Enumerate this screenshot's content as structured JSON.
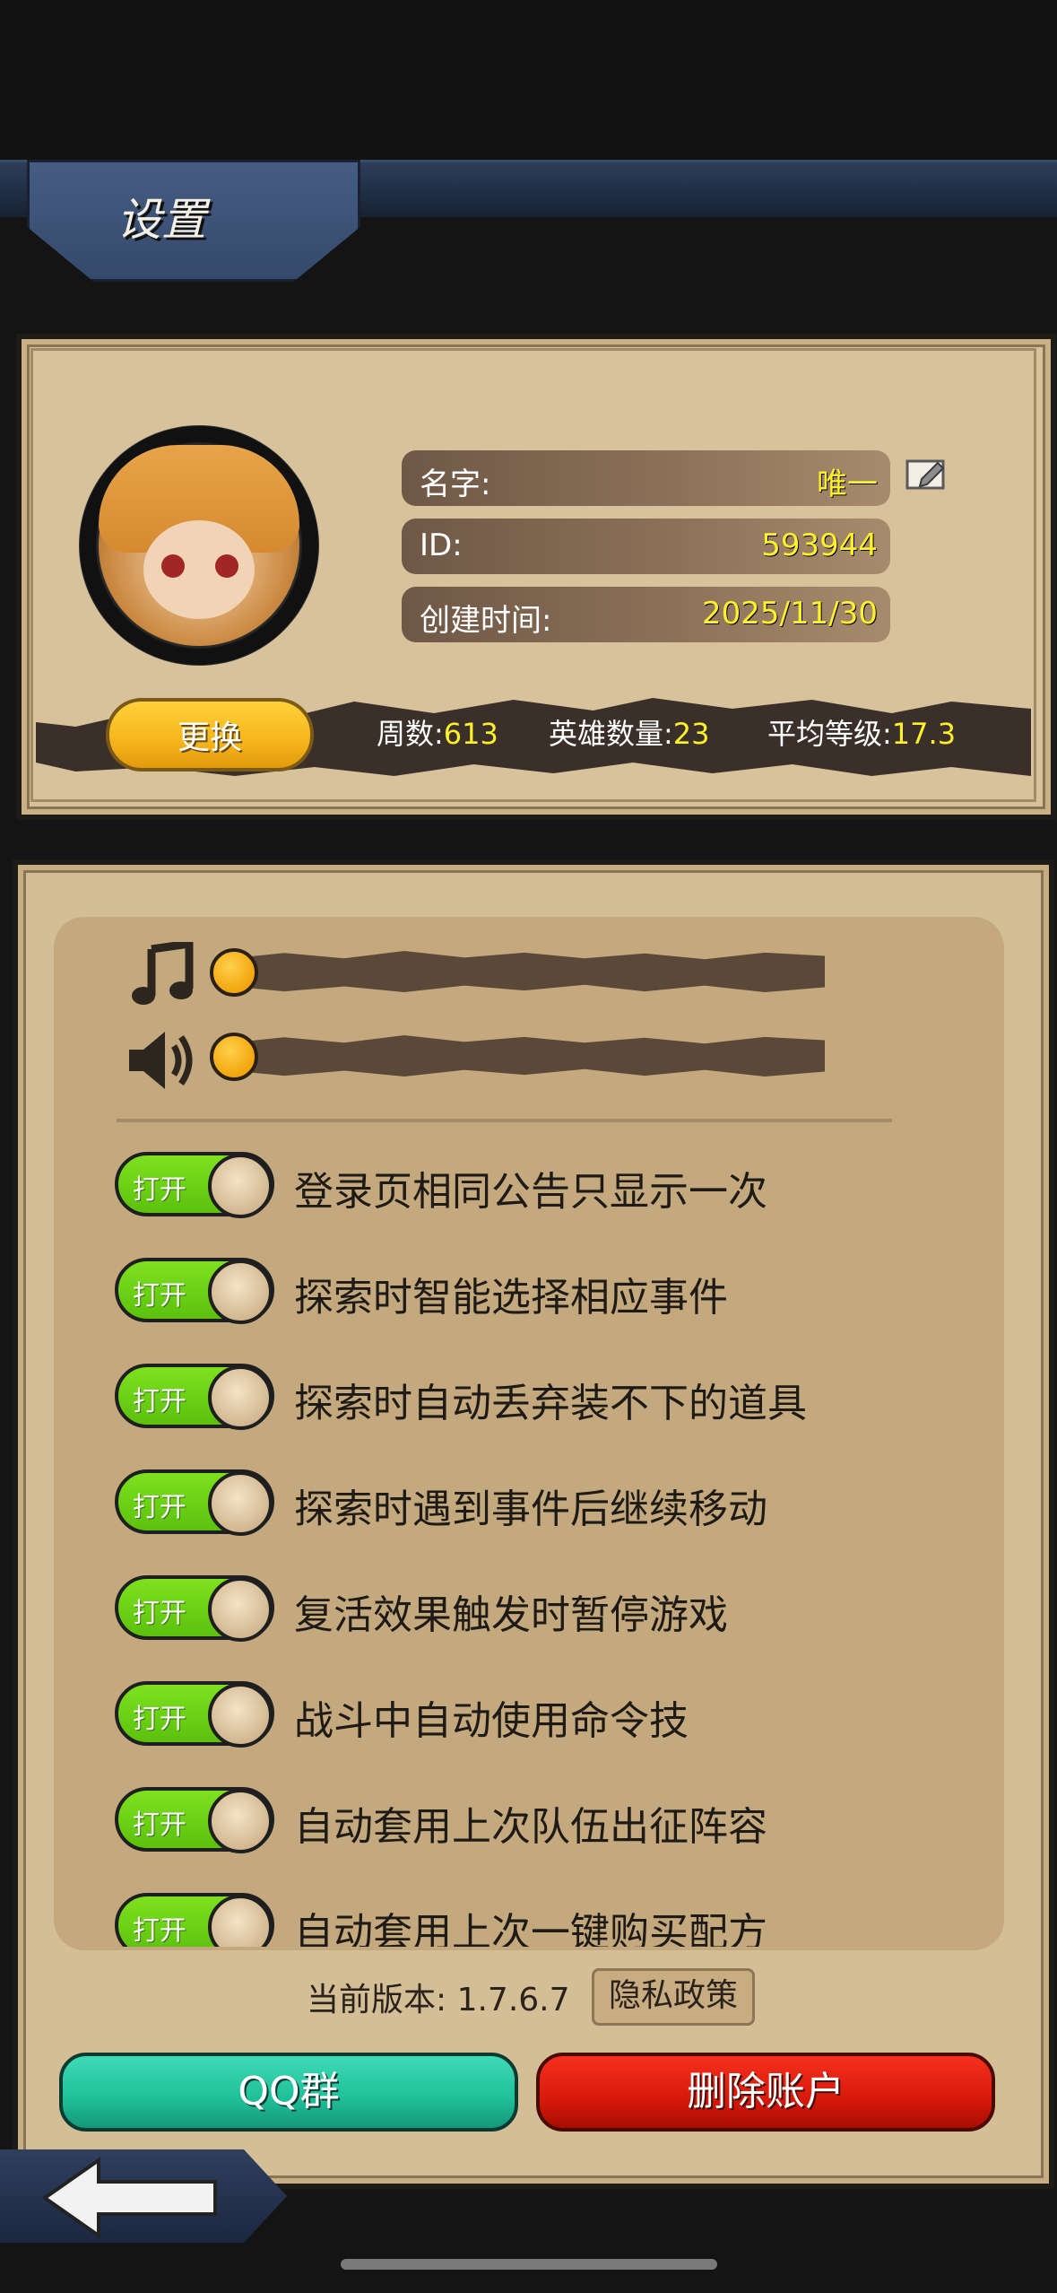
{
  "header": {
    "title": "设置"
  },
  "profile": {
    "name_label": "名字:",
    "name_value": "唯一",
    "id_label": "ID:",
    "id_value": "593944",
    "created_label": "创建时间:",
    "created_value": "2025/11/30",
    "change_button": "更换",
    "stats": {
      "weeks_label": "周数:",
      "weeks_value": "613",
      "heroes_label": "英雄数量:",
      "heroes_value": "23",
      "avg_level_label": "平均等级:",
      "avg_level_value": "17.3"
    }
  },
  "audio": {
    "music_icon": "music-note-icon",
    "sound_icon": "speaker-icon",
    "music_level": 0,
    "sound_level": 0
  },
  "toggles": [
    {
      "state": "打开",
      "label": "登录页相同公告只显示一次"
    },
    {
      "state": "打开",
      "label": "探索时智能选择相应事件"
    },
    {
      "state": "打开",
      "label": "探索时自动丢弃装不下的道具"
    },
    {
      "state": "打开",
      "label": "探索时遇到事件后继续移动"
    },
    {
      "state": "打开",
      "label": "复活效果触发时暂停游戏"
    },
    {
      "state": "打开",
      "label": "战斗中自动使用命令技"
    },
    {
      "state": "打开",
      "label": "自动套用上次队伍出征阵容"
    },
    {
      "state": "打开",
      "label": "自动套用上次一键购买配方"
    }
  ],
  "footer": {
    "version_text": "当前版本: 1.7.6.7",
    "privacy_button": "隐私政策",
    "qq_button": "QQ群",
    "delete_button": "删除账户"
  },
  "colors": {
    "toggle_on": "#6fd318",
    "value_yellow": "#fdf12b",
    "qq_green": "#1fbf98",
    "delete_red": "#d8190a"
  }
}
